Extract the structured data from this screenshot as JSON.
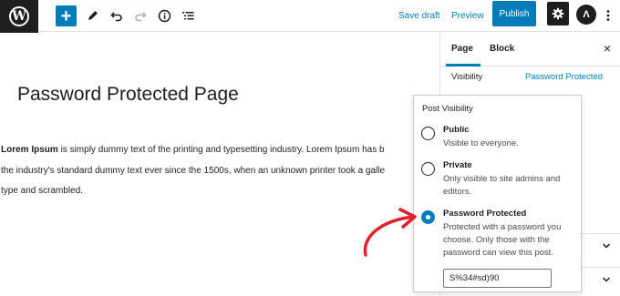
{
  "toolbar": {
    "logo_glyph": "W",
    "add_label": "+",
    "save_draft_label": "Save draft",
    "preview_label": "Preview",
    "publish_label": "Publish",
    "avatar_glyph": "Λ",
    "icons": [
      "wordpress-logo",
      "add-block",
      "pen-tool",
      "undo",
      "redo",
      "details-info",
      "list-view",
      "settings-gear",
      "more-vertical"
    ]
  },
  "editor": {
    "title": "Password Protected Page",
    "content_lead": "Lorem Ipsum",
    "content_line_1": " is simply dummy text of the printing and typesetting industry. Lorem Ipsum has b",
    "content_line_2": "the industry's standard dummy text ever since the 1500s, when an unknown printer took a galle",
    "content_line_3": "type and scrambled."
  },
  "sidebar": {
    "tabs": [
      {
        "label": "Page",
        "active": true
      },
      {
        "label": "Block",
        "active": false
      }
    ],
    "close_glyph": "×",
    "visibility_label": "Visibility",
    "visibility_value": "Password Protected"
  },
  "popover": {
    "title": "Post Visibility",
    "options": [
      {
        "label": "Public",
        "description": "Visible to everyone.",
        "checked": false
      },
      {
        "label": "Private",
        "description": "Only visible to site admins and editors.",
        "checked": false
      },
      {
        "label": "Password Protected",
        "description": "Protected with a password you choose. Only those with the password can view this post.",
        "checked": true
      }
    ],
    "password_value": "S%34#sd)90"
  },
  "colors": {
    "accent": "#007cba",
    "dark": "#1e1e1e",
    "annotation_arrow": "#e0202a"
  }
}
